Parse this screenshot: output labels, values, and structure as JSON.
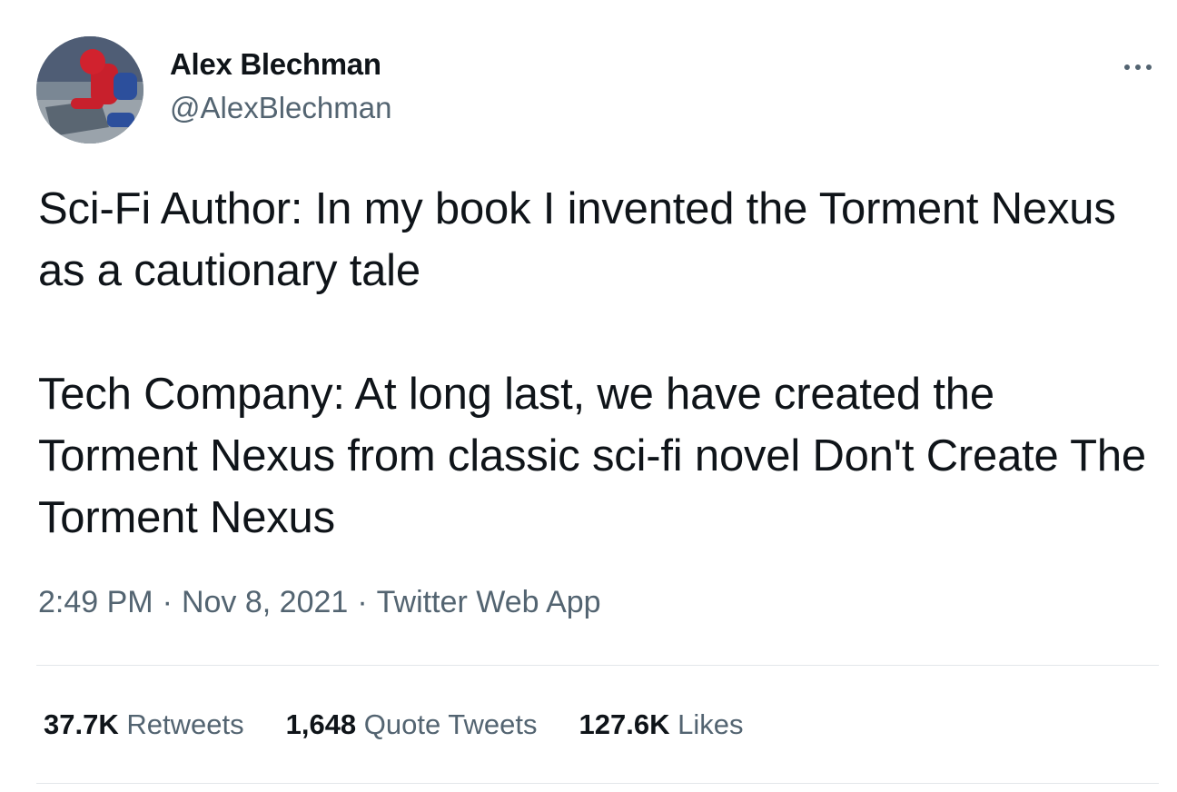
{
  "author": {
    "name": "Alex Blechman",
    "handle": "@AlexBlechman",
    "avatar_icon": "avatar-image"
  },
  "tweet": {
    "paragraphs": [
      "Sci-Fi Author: In my book I invented the Torment Nexus as a cautionary tale",
      "Tech Company: At long last, we have created the Torment Nexus from classic sci-fi novel Don't Create The Torment Nexus"
    ]
  },
  "meta": {
    "time": "2:49 PM",
    "separator": "·",
    "date": "Nov 8, 2021",
    "source": "Twitter Web App"
  },
  "stats": {
    "retweets": {
      "count": "37.7K",
      "label": "Retweets"
    },
    "quote_tweets": {
      "count": "1,648",
      "label": "Quote Tweets"
    },
    "likes": {
      "count": "127.6K",
      "label": "Likes"
    }
  },
  "more_icon": "more-horizontal-icon",
  "colors": {
    "text": "#0f1419",
    "secondary": "#536471",
    "divider": "#e3e7ea"
  }
}
